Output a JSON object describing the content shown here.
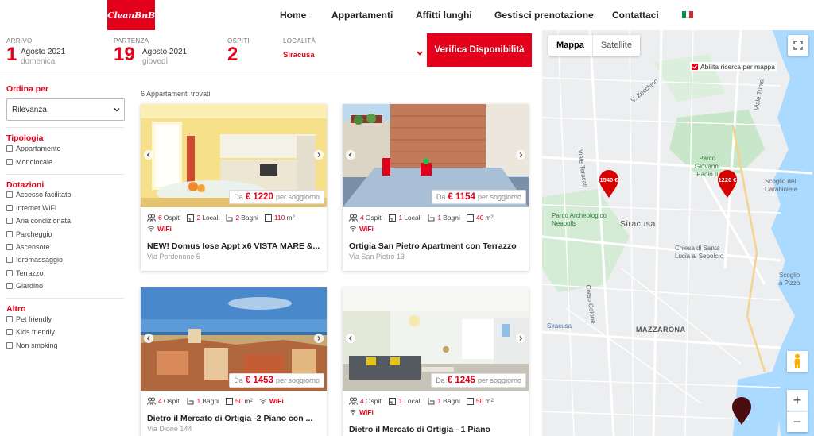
{
  "brand": {
    "logo_text": "CleanBnB",
    "accent": "#e3001b"
  },
  "nav": {
    "items": [
      "Home",
      "Appartamenti",
      "Affitti lunghi",
      "Gestisci prenotazione",
      "Contattaci"
    ],
    "language_flag": "italian-flag-icon"
  },
  "search": {
    "arrival": {
      "label": "ARRIVO",
      "day": "1",
      "month": "Agosto 2021",
      "weekday": "domenica"
    },
    "departure": {
      "label": "PARTENZA",
      "day": "19",
      "month": "Agosto 2021",
      "weekday": "giovedì"
    },
    "guests": {
      "label": "OSPITI",
      "value": "2"
    },
    "location": {
      "label": "LOCALITÀ",
      "value": "Siracusa"
    },
    "button": "Verifica Disponibilità"
  },
  "filters": {
    "sort": {
      "title": "Ordina per",
      "selected": "Rilevanza"
    },
    "type": {
      "title": "Tipologia",
      "options": [
        "Appartamento",
        "Monolocale"
      ]
    },
    "amenities": {
      "title": "Dotazioni",
      "options": [
        "Accesso facilitato",
        "Internet WiFi",
        "Aria condizionata",
        "Parcheggio",
        "Ascensore",
        "Idromassaggio",
        "Terrazzo",
        "Giardino"
      ]
    },
    "other": {
      "title": "Altro",
      "options": [
        "Pet friendly",
        "Kids friendly",
        "Non smoking"
      ]
    }
  },
  "results": {
    "count_text": "6 Appartamenti trovati",
    "price_prefix": "Da",
    "price_suffix": "per soggiorno",
    "labels": {
      "ospiti": "Ospiti",
      "locali": "Locali",
      "bagni": "Bagni",
      "wifi": "WiFi"
    },
    "cards": [
      {
        "price": "€ 1220",
        "guests": "6",
        "rooms": "2",
        "baths": "2",
        "size": "110",
        "size_unit": "m",
        "size_sup": "2",
        "title": "NEW! Domus Iose Appt x6 VISTA MARE &...",
        "address": "Via Pordenone 5"
      },
      {
        "price": "€ 1154",
        "guests": "4",
        "rooms": "1",
        "baths": "1",
        "size": "40",
        "size_unit": "m",
        "size_sup": "2",
        "title": "Ortigia San Pietro Apartment con Terrazzo",
        "address": "Via San Pietro 13"
      },
      {
        "price": "€ 1453",
        "guests": "4",
        "baths": "1",
        "size": "50",
        "size_unit": "m",
        "size_sup": "2",
        "title": "Dietro il Mercato di Ortigia -2 Piano con ...",
        "address": "Via Dione 144"
      },
      {
        "price": "€ 1245",
        "guests": "4",
        "rooms": "1",
        "baths": "1",
        "size": "50",
        "size_unit": "m",
        "size_sup": "2",
        "title": "Dietro il Mercato di Ortigia - 1 Piano",
        "address": ""
      }
    ]
  },
  "map": {
    "tabs": [
      "Mappa",
      "Satellite"
    ],
    "search_on_map": "Abilita ricerca per mappa",
    "pins": [
      "1540 €",
      "1220 €"
    ],
    "labels": {
      "parco": "Parco\nGiovanni\nPaolo II",
      "archeo": "Parco Archeologico\nNeapolis",
      "siracusa": "Siracusa",
      "chiesa": "Chiesa di Santa\nLucia al Sepolcro",
      "mazzarona": "MAZZARONA",
      "scoglio": "Scoglio del\nCarabiniere",
      "pizzo": "Scoglio\na Pizzo",
      "viale_teracati": "Viale Teracati",
      "viale_tunisi": "Viale Tunisi",
      "corso_gelone": "Corso Gelone",
      "siracusa_small": "Siracusa",
      "via_zecchino": "V. Zecchino"
    },
    "zoom_in": "+",
    "zoom_out": "−"
  }
}
